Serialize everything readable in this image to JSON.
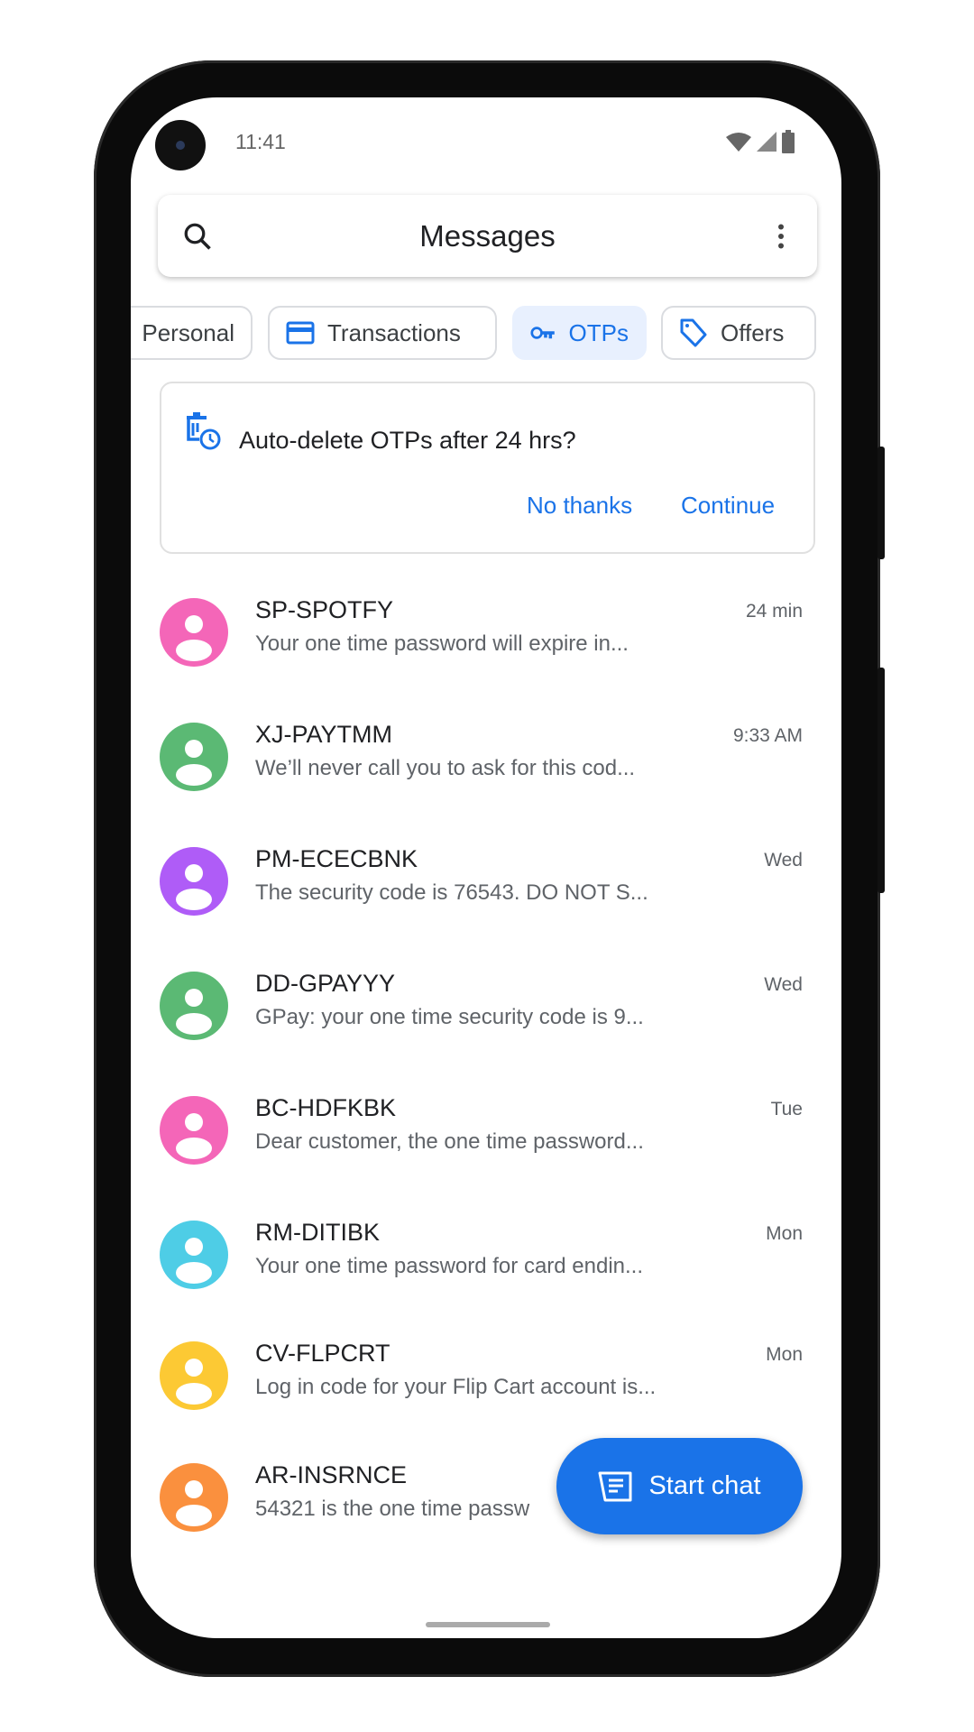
{
  "status_bar": {
    "time": "11:41"
  },
  "search_bar": {
    "title": "Messages",
    "search_icon": "search-icon",
    "menu_icon": "more-vert-icon"
  },
  "chips": [
    {
      "label": "Personal",
      "active": false
    },
    {
      "label": "Transactions",
      "icon": "credit-card-icon",
      "active": false
    },
    {
      "label": "OTPs",
      "icon": "key-icon",
      "active": true
    },
    {
      "label": "Offers",
      "icon": "tag-icon",
      "active": false
    }
  ],
  "banner": {
    "icon": "auto-delete-icon",
    "text": "Auto-delete OTPs after 24 hrs?",
    "no_thanks": "No thanks",
    "continue": "Continue"
  },
  "conversations": [
    {
      "name": "SP-SPOTFY",
      "preview": "Your one time password will expire in...",
      "time": "24 min",
      "color": "#f466b8"
    },
    {
      "name": "XJ-PAYTMM",
      "preview": "We’ll never call you to ask for this cod...",
      "time": "9:33 AM",
      "color": "#5bb974"
    },
    {
      "name": "PM-ECECBNK",
      "preview": "The security code is 76543. DO NOT S...",
      "time": "Wed",
      "color": "#af5cf7"
    },
    {
      "name": "DD-GPAYYY",
      "preview": "GPay: your one time security code is 9...",
      "time": "Wed",
      "color": "#5bb974"
    },
    {
      "name": "BC-HDFKBK",
      "preview": "Dear customer, the one time password...",
      "time": "Tue",
      "color": "#f466b8"
    },
    {
      "name": "RM-DITIBK",
      "preview": "Your one time password for card endin...",
      "time": "Mon",
      "color": "#4ecde6"
    },
    {
      "name": "CV-FLPCRT",
      "preview": "Log in code for your Flip Cart account is...",
      "time": "Mon",
      "color": "#fcc934"
    },
    {
      "name": "AR-INSRNCE",
      "preview": "54321 is the one time passw",
      "time": "",
      "color": "#fa903e"
    }
  ],
  "fab": {
    "label": "Start chat",
    "icon": "chat-icon"
  },
  "colors": {
    "accent": "#1a73e8",
    "chip_active_bg": "#e8f0fe"
  }
}
